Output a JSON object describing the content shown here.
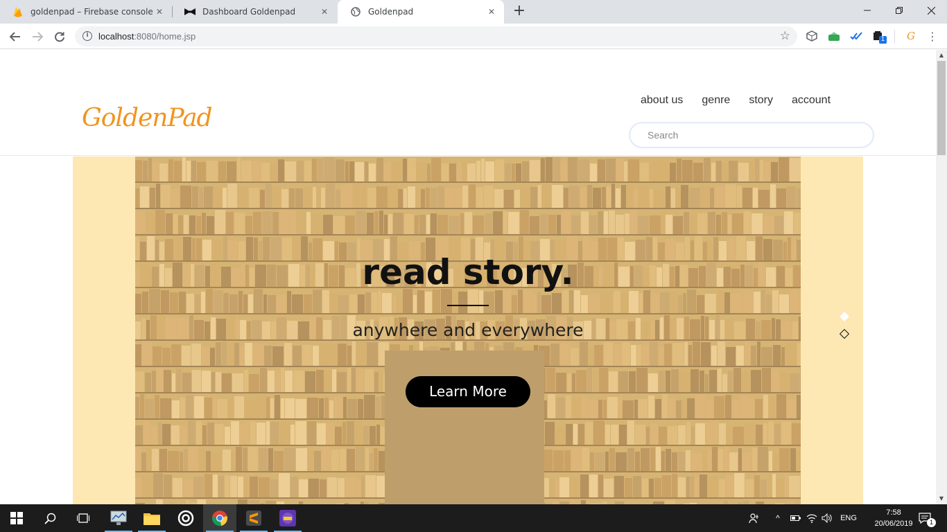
{
  "browser": {
    "tabs": [
      {
        "title": "goldenpad – Firebase console",
        "icon": "firebase-icon",
        "active": false
      },
      {
        "title": "Dashboard Goldenpad",
        "icon": "bowtie-icon",
        "active": false
      },
      {
        "title": "Goldenpad",
        "icon": "globe-icon",
        "active": true
      }
    ],
    "url_host": "localhost",
    "url_rest": ":8080/home.jsp",
    "extension_badge": "1"
  },
  "site": {
    "logo_text": "GoldenPad",
    "nav": [
      "about us",
      "genre",
      "story",
      "account"
    ],
    "search_placeholder": "Search",
    "hero": {
      "title": "read story.",
      "subtitle": "anywhere and everywhere",
      "button_label": "Learn More",
      "slides": 2,
      "active_slide": 1
    }
  },
  "taskbar": {
    "apps": [
      "start-button",
      "search-button",
      "task-view-button",
      "app-monitor",
      "file-explorer",
      "app-circle",
      "chrome",
      "sublime-text",
      "game-app"
    ],
    "language": "ENG",
    "time": "7:58",
    "date": "20/06/2019",
    "notification_count": "1"
  },
  "colors": {
    "brand_orange": "#f0951f",
    "hero_band": "#fde7b2",
    "button_black": "#000000"
  }
}
